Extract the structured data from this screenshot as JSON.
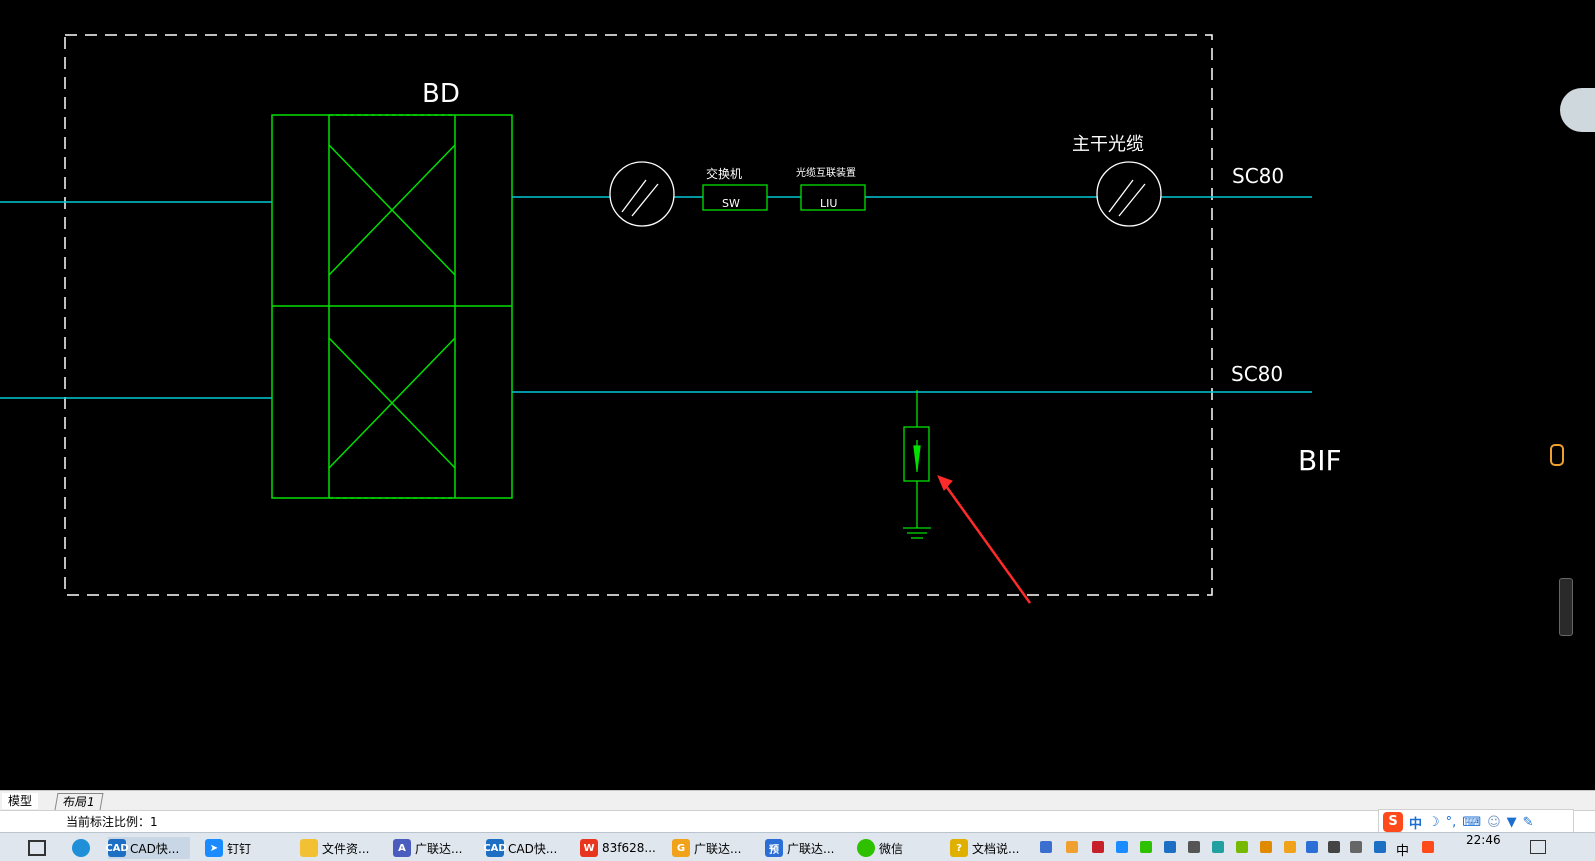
{
  "drawing": {
    "bd_label": "BD",
    "switch_label": "交换机",
    "switch_code": "SW",
    "liu_label": "光缆互联装置",
    "liu_code": "LIU",
    "trunk_cable_label": "主干光缆",
    "conduit_top": "SC80",
    "conduit_bottom": "SC80",
    "floor_label": "BIF",
    "colors": {
      "cyan": "#00c8d8",
      "green": "#00e000",
      "red": "#ff2a2a"
    }
  },
  "layout_tabs": {
    "model": "模型",
    "layout1": "布局1"
  },
  "status": {
    "annotation_scale": "当前标注比例：1"
  },
  "taskbar": {
    "items": [
      {
        "label": "CAD快...",
        "icon": "cad-icon"
      },
      {
        "label": "钉钉",
        "icon": "dingtalk-icon"
      },
      {
        "label": "文件资...",
        "icon": "folder-icon"
      },
      {
        "label": "广联达...",
        "icon": "glodon-icon"
      },
      {
        "label": "CAD快...",
        "icon": "cad-icon"
      },
      {
        "label": "83f628...",
        "icon": "wps-icon"
      },
      {
        "label": "广联达...",
        "icon": "glodon-icon"
      },
      {
        "label": "广联达...",
        "icon": "glodon-icon"
      },
      {
        "label": "微信",
        "icon": "wechat-icon"
      },
      {
        "label": "文档说...",
        "icon": "doc-icon"
      }
    ],
    "clock": "22:46",
    "ime_lang": "中"
  }
}
